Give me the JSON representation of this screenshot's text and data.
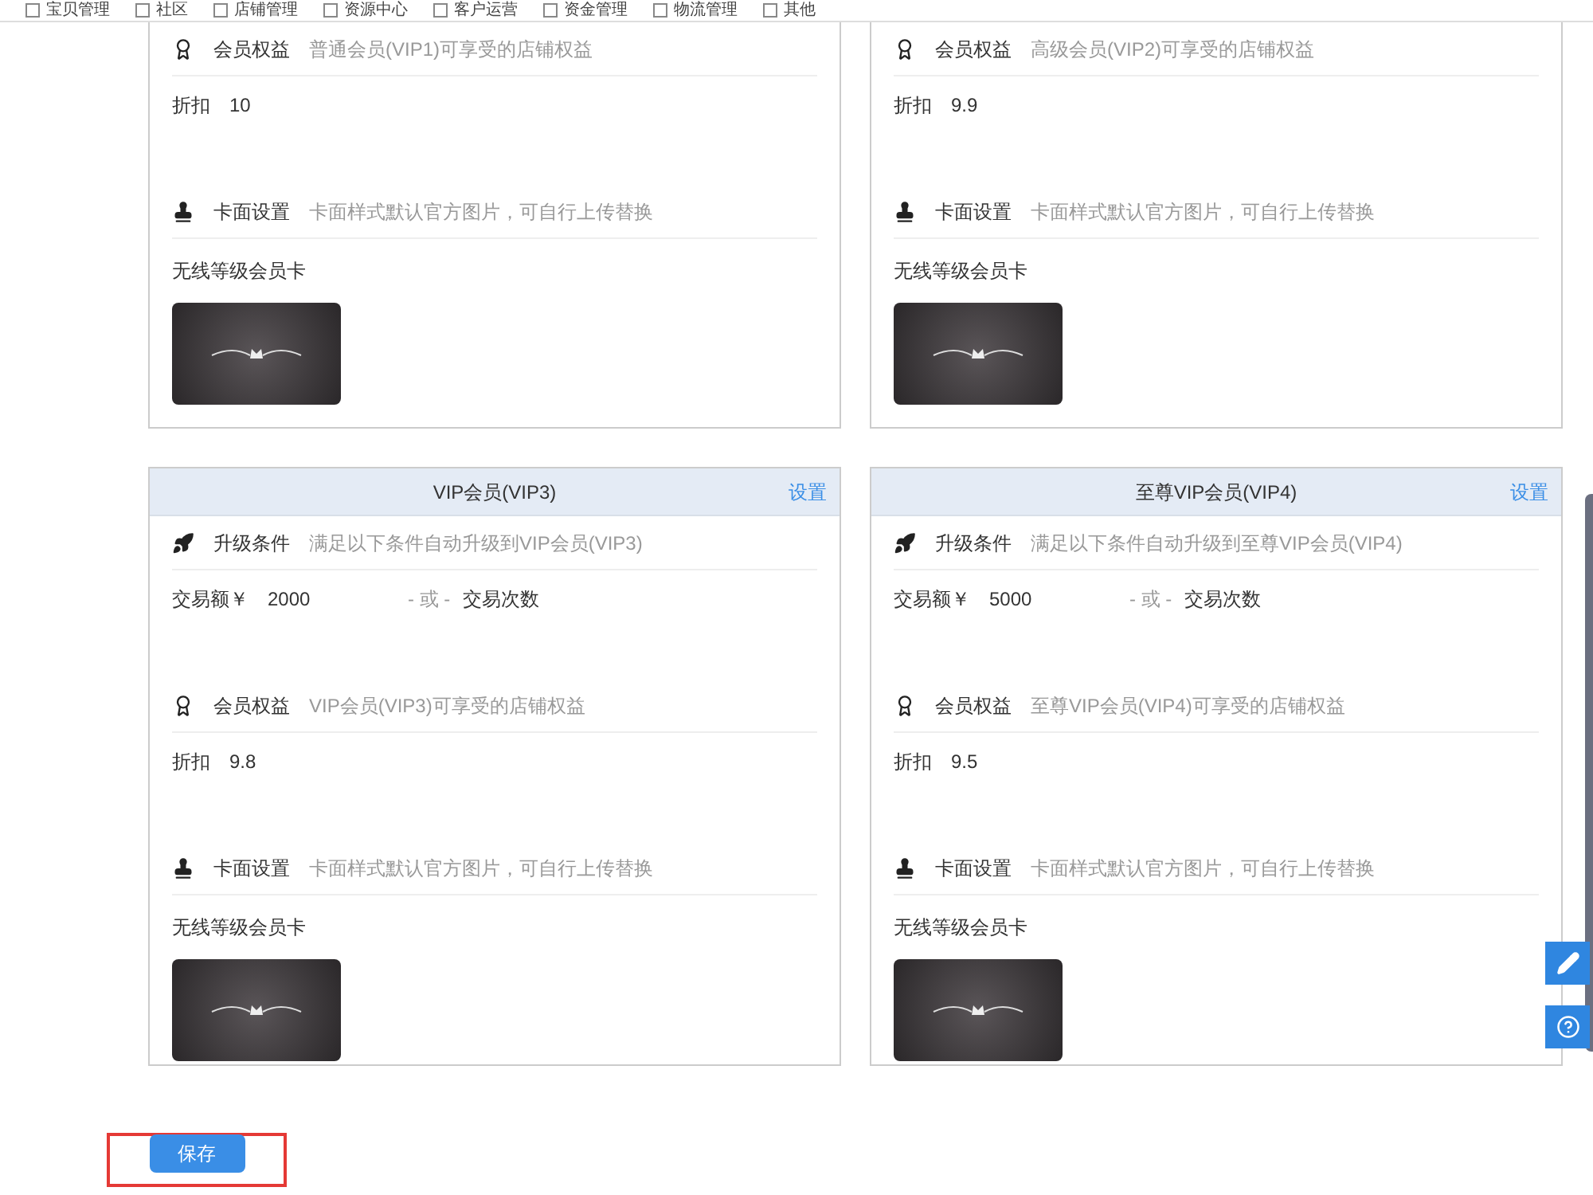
{
  "permissions": [
    {
      "label": "宝贝管理",
      "checked": false
    },
    {
      "label": "社区",
      "checked": false
    },
    {
      "label": "店铺管理",
      "checked": false
    },
    {
      "label": "资源中心",
      "checked": false
    },
    {
      "label": "客户运营",
      "checked": false
    },
    {
      "label": "资金管理",
      "checked": false
    },
    {
      "label": "物流管理",
      "checked": false
    },
    {
      "label": "其他",
      "checked": false
    }
  ],
  "card_rows": [
    {
      "cards": [
        {
          "sections": [
            {
              "kind": "benefit",
              "title": "会员权益",
              "hint": "普通会员(VIP1)可享受的店铺权益",
              "label": "折扣",
              "value": "10"
            },
            {
              "kind": "cardface",
              "title": "卡面设置",
              "hint": "卡面样式默认官方图片，可自行上传替换",
              "label": "无线等级会员卡"
            }
          ]
        },
        {
          "sections": [
            {
              "kind": "benefit",
              "title": "会员权益",
              "hint": "高级会员(VIP2)可享受的店铺权益",
              "label": "折扣",
              "value": "9.9"
            },
            {
              "kind": "cardface",
              "title": "卡面设置",
              "hint": "卡面样式默认官方图片，可自行上传替换",
              "label": "无线等级会员卡"
            }
          ]
        }
      ]
    },
    {
      "cards": [
        {
          "header": {
            "title": "VIP会员(VIP3)",
            "action": "设置"
          },
          "sections": [
            {
              "kind": "upgrade",
              "title": "升级条件",
              "hint": "满足以下条件自动升级到VIP会员(VIP3)",
              "label": "交易额￥",
              "value": "2000",
              "or": "- 或 -",
              "alt": "交易次数"
            },
            {
              "kind": "benefit",
              "title": "会员权益",
              "hint": "VIP会员(VIP3)可享受的店铺权益",
              "label": "折扣",
              "value": "9.8"
            },
            {
              "kind": "cardface",
              "title": "卡面设置",
              "hint": "卡面样式默认官方图片，可自行上传替换",
              "label": "无线等级会员卡"
            }
          ]
        },
        {
          "header": {
            "title": "至尊VIP会员(VIP4)",
            "action": "设置"
          },
          "sections": [
            {
              "kind": "upgrade",
              "title": "升级条件",
              "hint": "满足以下条件自动升级到至尊VIP会员(VIP4)",
              "label": "交易额￥",
              "value": "5000",
              "or": "- 或 -",
              "alt": "交易次数"
            },
            {
              "kind": "benefit",
              "title": "会员权益",
              "hint": "至尊VIP会员(VIP4)可享受的店铺权益",
              "label": "折扣",
              "value": "9.5"
            },
            {
              "kind": "cardface",
              "title": "卡面设置",
              "hint": "卡面样式默认官方图片，可自行上传替换",
              "label": "无线等级会员卡"
            }
          ]
        }
      ]
    }
  ],
  "save_button": "保存"
}
